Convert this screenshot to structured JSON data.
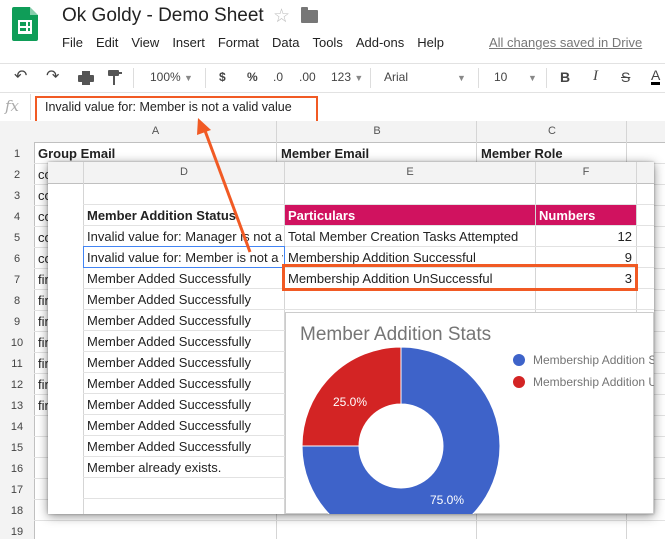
{
  "app": {
    "title": "Ok Goldy - Demo Sheet",
    "saved_status": "All changes saved in Drive",
    "menu": [
      "File",
      "Edit",
      "View",
      "Insert",
      "Format",
      "Data",
      "Tools",
      "Add-ons",
      "Help"
    ],
    "star_icon": "star-icon",
    "folder_icon": "folder-icon"
  },
  "toolbar": {
    "zoom": "100%",
    "currency": "$",
    "percent": "%",
    "decimal_less": ".0",
    "decimal_more": ".00",
    "more_formats": "123",
    "font": "Arial",
    "font_size": "10",
    "bold": "B",
    "italic": "I",
    "strike": "S",
    "text_color": "A"
  },
  "formula": {
    "fx_label": "fx",
    "value": "Invalid value for: Member is not a valid value"
  },
  "back_sheet": {
    "columns": [
      "A",
      "B",
      "C"
    ],
    "row_numbers": [
      "1",
      "2",
      "3",
      "4",
      "5",
      "6",
      "7",
      "8",
      "9",
      "10",
      "11",
      "12",
      "13",
      "14",
      "15",
      "16",
      "17",
      "18",
      "19"
    ],
    "headers": [
      "Group Email",
      "Member Email",
      "Member Role"
    ],
    "col_a_stubs": [
      "co",
      "co",
      "co",
      "co",
      "co",
      "fir",
      "fir",
      "fir",
      "fir",
      "fir",
      "fir",
      "fir"
    ]
  },
  "front_sheet": {
    "columns": [
      "D",
      "E",
      "F"
    ],
    "status_header": "Member Addition Status",
    "status_rows": [
      "Invalid value for: Manager is not a valid value",
      "Invalid value for: Member is not a valid value",
      "Member Added Successfully",
      "Member Added Successfully",
      "Member Added Successfully",
      "Member Added Successfully",
      "Member Added Successfully",
      "Member Added Successfully",
      "Member Added Successfully",
      "Member Added Successfully",
      "Member Added Successfully",
      "Member already exists."
    ],
    "summary_headers": [
      "Particulars",
      "Numbers"
    ],
    "summary_rows": [
      {
        "label": "Total Member Creation Tasks Attempted",
        "value": "12"
      },
      {
        "label": "Membership Addition Successful",
        "value": "9"
      },
      {
        "label": "Membership Addition UnSuccessful",
        "value": "3"
      }
    ]
  },
  "chart_data": {
    "type": "pie",
    "title": "Member Addition Stats",
    "donut": true,
    "series": [
      {
        "name": "Membership Addition Successful",
        "value": 75.0,
        "label": "75.0%",
        "color": "#3e63c9"
      },
      {
        "name": "Membership Addition UnSuccessful",
        "value": 25.0,
        "label": "25.0%",
        "color": "#d32424"
      }
    ],
    "legend_labels": [
      "Membership Addition S",
      "Membership Addition U"
    ],
    "legend_position": "right"
  },
  "colors": {
    "accent_highlight": "#f15a24",
    "header_magenta": "#d0125f",
    "sheets_green": "#0f9d58"
  }
}
